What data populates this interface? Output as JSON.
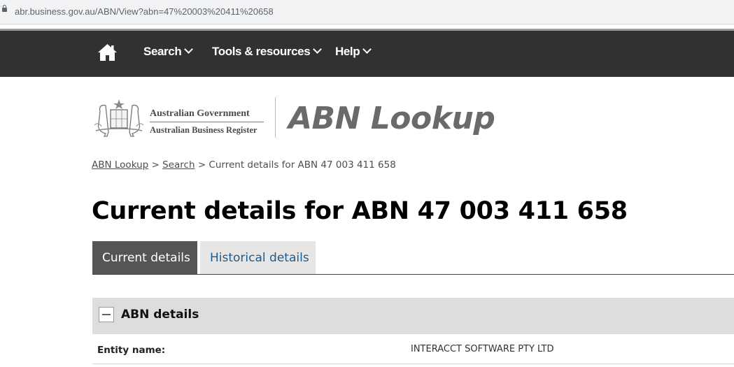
{
  "browser": {
    "url": "abr.business.gov.au/ABN/View?abn=47%20003%20411%20658"
  },
  "nav": {
    "home_icon": "home-icon",
    "items": [
      {
        "label": "Search"
      },
      {
        "label": "Tools & resources"
      },
      {
        "label": "Help"
      }
    ]
  },
  "header": {
    "gov_name": "Australian Government",
    "register_name": "Australian Business Register",
    "brand": "ABN Lookup"
  },
  "breadcrumb": {
    "home": "ABN Lookup",
    "sep": ">",
    "search": "Search",
    "current": "Current details for ABN 47 003 411 658"
  },
  "page": {
    "title": "Current details for ABN 47 003 411 658"
  },
  "tabs": [
    {
      "label": "Current details",
      "active": true
    },
    {
      "label": "Historical details",
      "active": false
    }
  ],
  "section": {
    "title": "ABN details",
    "rows": [
      {
        "label": "Entity name:",
        "value": "INTERACCT SOFTWARE PTY LTD"
      }
    ]
  },
  "colors": {
    "nav_bg": "#313131",
    "tab_active": "#555555",
    "tab_inactive": "#e6e6e6",
    "link": "#1f5a8c"
  }
}
